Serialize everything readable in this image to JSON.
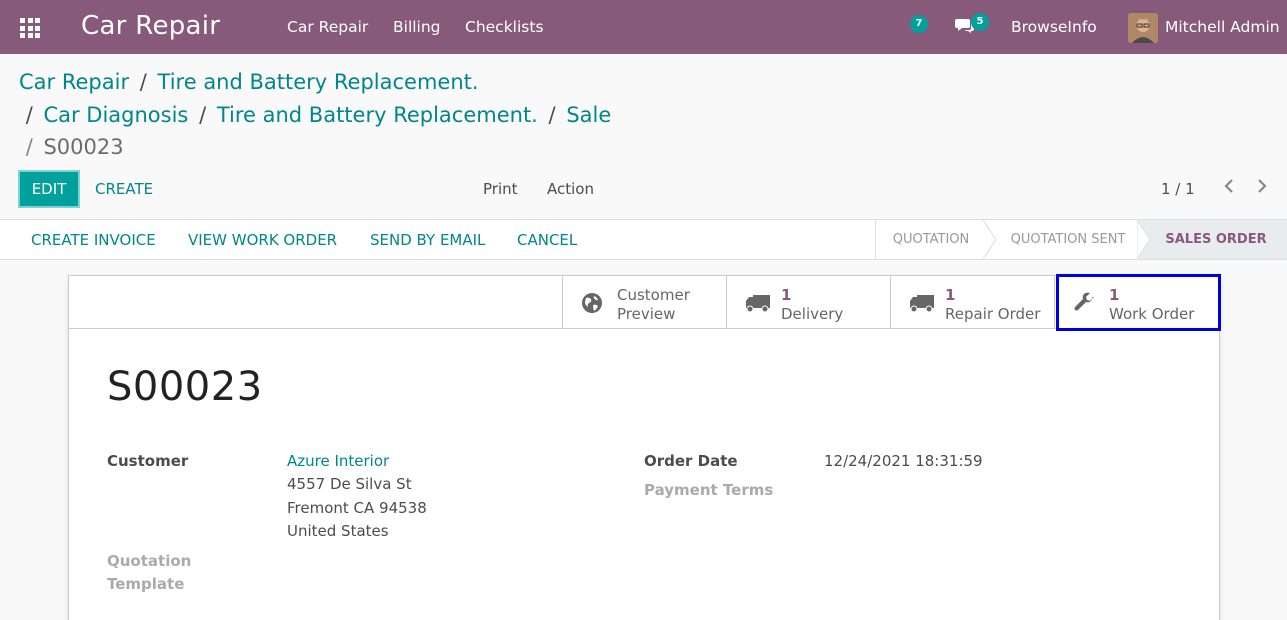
{
  "navbar": {
    "brand": "Car Repair",
    "menu": [
      "Car Repair",
      "Billing",
      "Checklists"
    ],
    "activity_count": "7",
    "message_count": "5",
    "company": "BrowseInfo",
    "user": "Mitchell Admin"
  },
  "breadcrumb": {
    "items": [
      "Car Repair",
      "Tire and Battery Replacement.",
      "Car Diagnosis",
      "Tire and Battery Replacement.",
      "Sale"
    ],
    "current": "S00023",
    "sep": "/"
  },
  "controls": {
    "edit": "EDIT",
    "create": "CREATE",
    "print": "Print",
    "action": "Action",
    "pager": "1 / 1"
  },
  "statusbar": {
    "buttons": [
      "CREATE INVOICE",
      "VIEW WORK ORDER",
      "SEND BY EMAIL",
      "CANCEL"
    ],
    "stages": [
      "QUOTATION",
      "QUOTATION SENT",
      "SALES ORDER"
    ],
    "active_stage": "SALES ORDER"
  },
  "smart_buttons": {
    "customer_preview": [
      "Customer",
      "Preview"
    ],
    "delivery": {
      "count": "1",
      "label": "Delivery"
    },
    "repair_order": {
      "count": "1",
      "label": "Repair Order"
    },
    "work_order": {
      "count": "1",
      "label": "Work Order"
    }
  },
  "record": {
    "name": "S00023",
    "customer_label": "Customer",
    "customer_name": "Azure Interior",
    "customer_address": [
      "4557 De Silva St",
      "Fremont CA 94538",
      "United States"
    ],
    "quotation_template_label": [
      "Quotation",
      "Template"
    ],
    "order_date_label": "Order Date",
    "order_date": "12/24/2021 18:31:59",
    "payment_terms_label": "Payment Terms"
  },
  "colors": {
    "brand": "#875a7b",
    "accent": "#00a09d",
    "link": "#00868b",
    "highlight": "#0000e6"
  }
}
